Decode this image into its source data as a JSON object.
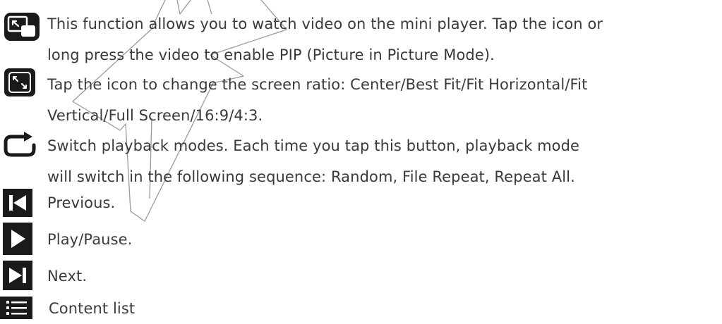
{
  "entries": [
    {
      "icon": "pip-icon",
      "lines": [
        "This function allows you to watch video on the mini player. Tap the icon or",
        "long press the video to enable PIP (Picture in Picture Mode)."
      ]
    },
    {
      "icon": "screen-ratio-icon",
      "lines": [
        "Tap the icon to change the screen ratio: Center/Best Fit/Fit Horizontal/Fit",
        "Vertical/Full Screen/16:9/4:3."
      ]
    },
    {
      "icon": "repeat-icon",
      "lines": [
        "Switch playback modes. Each time you tap this button, playback mode",
        "will switch in the following sequence: Random, File Repeat, Repeat All."
      ]
    },
    {
      "icon": "previous-icon",
      "lines": [
        "Previous."
      ]
    },
    {
      "icon": "play-icon",
      "lines": [
        "Play/Pause."
      ]
    },
    {
      "icon": "next-icon",
      "lines": [
        "Next."
      ]
    },
    {
      "icon": "list-icon",
      "lines": [
        "Content list"
      ]
    }
  ],
  "colors": {
    "text": "#3a3a3a",
    "icon": "#1a1a1a",
    "watermark": "#9a9a9a"
  }
}
